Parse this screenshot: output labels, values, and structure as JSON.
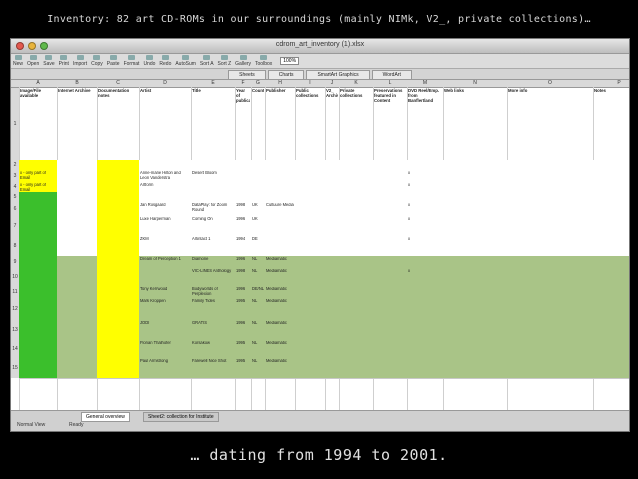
{
  "slide": {
    "title": "Inventory: 82 art CD-ROMs in our surroundings (mainly NIMk, V2_, private collections)…",
    "caption": "… dating from 1994 to 2001."
  },
  "window": {
    "title": "cdrom_art_inventory (1).xlsx",
    "toolbar": [
      "New",
      "Open",
      "Save",
      "Print",
      "Import",
      "Copy",
      "Paste",
      "Format",
      "Undo",
      "Redo",
      "AutoSum",
      "Sort A",
      "Sort Z",
      "Gallery",
      "Toolbox"
    ],
    "zoom": "100%",
    "ribbon_tabs": [
      "Sheets",
      "Charts",
      "SmartArt Graphics",
      "WordArt"
    ]
  },
  "grid": {
    "columns": [
      "A",
      "B",
      "C",
      "D",
      "E",
      "F",
      "G",
      "H",
      "I",
      "J",
      "K",
      "L",
      "M",
      "N",
      "O",
      "P"
    ],
    "headers": [
      "Image/File available",
      "Internet Archive",
      "Documentation notes",
      "Artist",
      "Title",
      "Year of publication",
      "Country",
      "Publisher",
      "Public collections",
      "V2_ Archive",
      "Private collections",
      "Preservations featured in Content",
      "DVD Reel/Emp. from Banflertland",
      "Web links",
      "More info",
      "Notes"
    ],
    "row_numbers": [
      "1",
      "2",
      "3",
      "4",
      "5",
      "6",
      "7",
      "8",
      "9",
      "10",
      "11",
      "12",
      "13",
      "14",
      "15"
    ],
    "rows": [
      {
        "a": "",
        "c": "",
        "d": "",
        "e": "",
        "f": "",
        "g": "",
        "h": "",
        "m": "",
        "o": "",
        "color": "#ffffff"
      },
      {
        "a": "x - only part of Email",
        "c": "",
        "d": "Anne-marie Hilton and Leon Vanderstra",
        "e": "Desert Bloom",
        "f": "",
        "g": "",
        "h": "",
        "m": "x",
        "o": "",
        "color": "#ffffff"
      },
      {
        "a": "x - only part of Email",
        "c": "",
        "d": "Artform",
        "e": "",
        "f": "",
        "g": "",
        "h": "",
        "m": "x",
        "o": "",
        "color": "#ffffff"
      },
      {
        "a": "",
        "c": "",
        "d": "",
        "e": "",
        "f": "",
        "g": "",
        "h": "",
        "m": "",
        "o": "",
        "color": "#ffffff"
      },
      {
        "a": "",
        "c": "",
        "d": "Jan Rosgaard",
        "e": "DataPlay: for Zoom Round",
        "f": "1998",
        "g": "UK",
        "h": "Cultuure Media",
        "m": "x",
        "o": "",
        "color": "#ffffff"
      },
      {
        "a": "",
        "c": "",
        "d": "Luxe Harperman",
        "e": "Coming On",
        "f": "1996",
        "g": "UK",
        "h": "",
        "m": "x",
        "o": "",
        "color": "#ffffff"
      },
      {
        "a": "",
        "c": "",
        "d": "ZKM",
        "e": "Artintact 1",
        "f": "1994",
        "g": "DE",
        "h": "",
        "m": "x",
        "o": "",
        "color": "#ffffff"
      },
      {
        "a": "",
        "c": "",
        "d": "Dream of Perception 1",
        "e": "Diamone",
        "f": "1996",
        "g": "NL",
        "h": "Mediamatic",
        "m": "",
        "o": "",
        "color": "#a9c487"
      },
      {
        "a": "",
        "c": "",
        "d": "",
        "e": "VIC-LINES Anthology",
        "f": "1998",
        "g": "NL",
        "h": "Mediamatic",
        "m": "x",
        "o": "",
        "color": "#a9c487"
      },
      {
        "a": "",
        "c": "",
        "d": "Tony Kerrwood",
        "e": "Bodyworlds of Perplexion",
        "f": "1996",
        "g": "DE/NL/S",
        "h": "Mediamatic",
        "m": "",
        "o": "",
        "color": "#a9c487"
      },
      {
        "a": "",
        "c": "",
        "d": "Mark Kroppen",
        "e": "Family Tides",
        "f": "1995",
        "g": "NL",
        "h": "Mediamatic",
        "m": "",
        "o": "",
        "color": "#a9c487"
      },
      {
        "a": "",
        "c": "",
        "d": "JODI",
        "e": "GRATIS",
        "f": "1996",
        "g": "NL",
        "h": "Mediamatic",
        "m": "",
        "o": "",
        "color": "#a9c487"
      },
      {
        "a": "",
        "c": "",
        "d": "Florian Thalhofer",
        "e": "Korsakow",
        "f": "1995",
        "g": "NL",
        "h": "Mediamatic",
        "m": "",
        "o": "",
        "color": "#a9c487"
      },
      {
        "a": "",
        "c": "",
        "d": "Paul Armstrong",
        "e": "Farewell Nice Shot",
        "f": "1995",
        "g": "NL",
        "h": "Mediamatic",
        "m": "",
        "o": "",
        "color": "#a9c487"
      }
    ]
  },
  "status": {
    "sheet_tabs": [
      "General overview",
      "Sheet2: collection for Institute"
    ],
    "view": "Normal View",
    "state": "Ready"
  },
  "colors": {
    "green_fill": "#3bbf2c",
    "yellow_fill": "#ffff00",
    "sage_row": "#a9c487"
  }
}
